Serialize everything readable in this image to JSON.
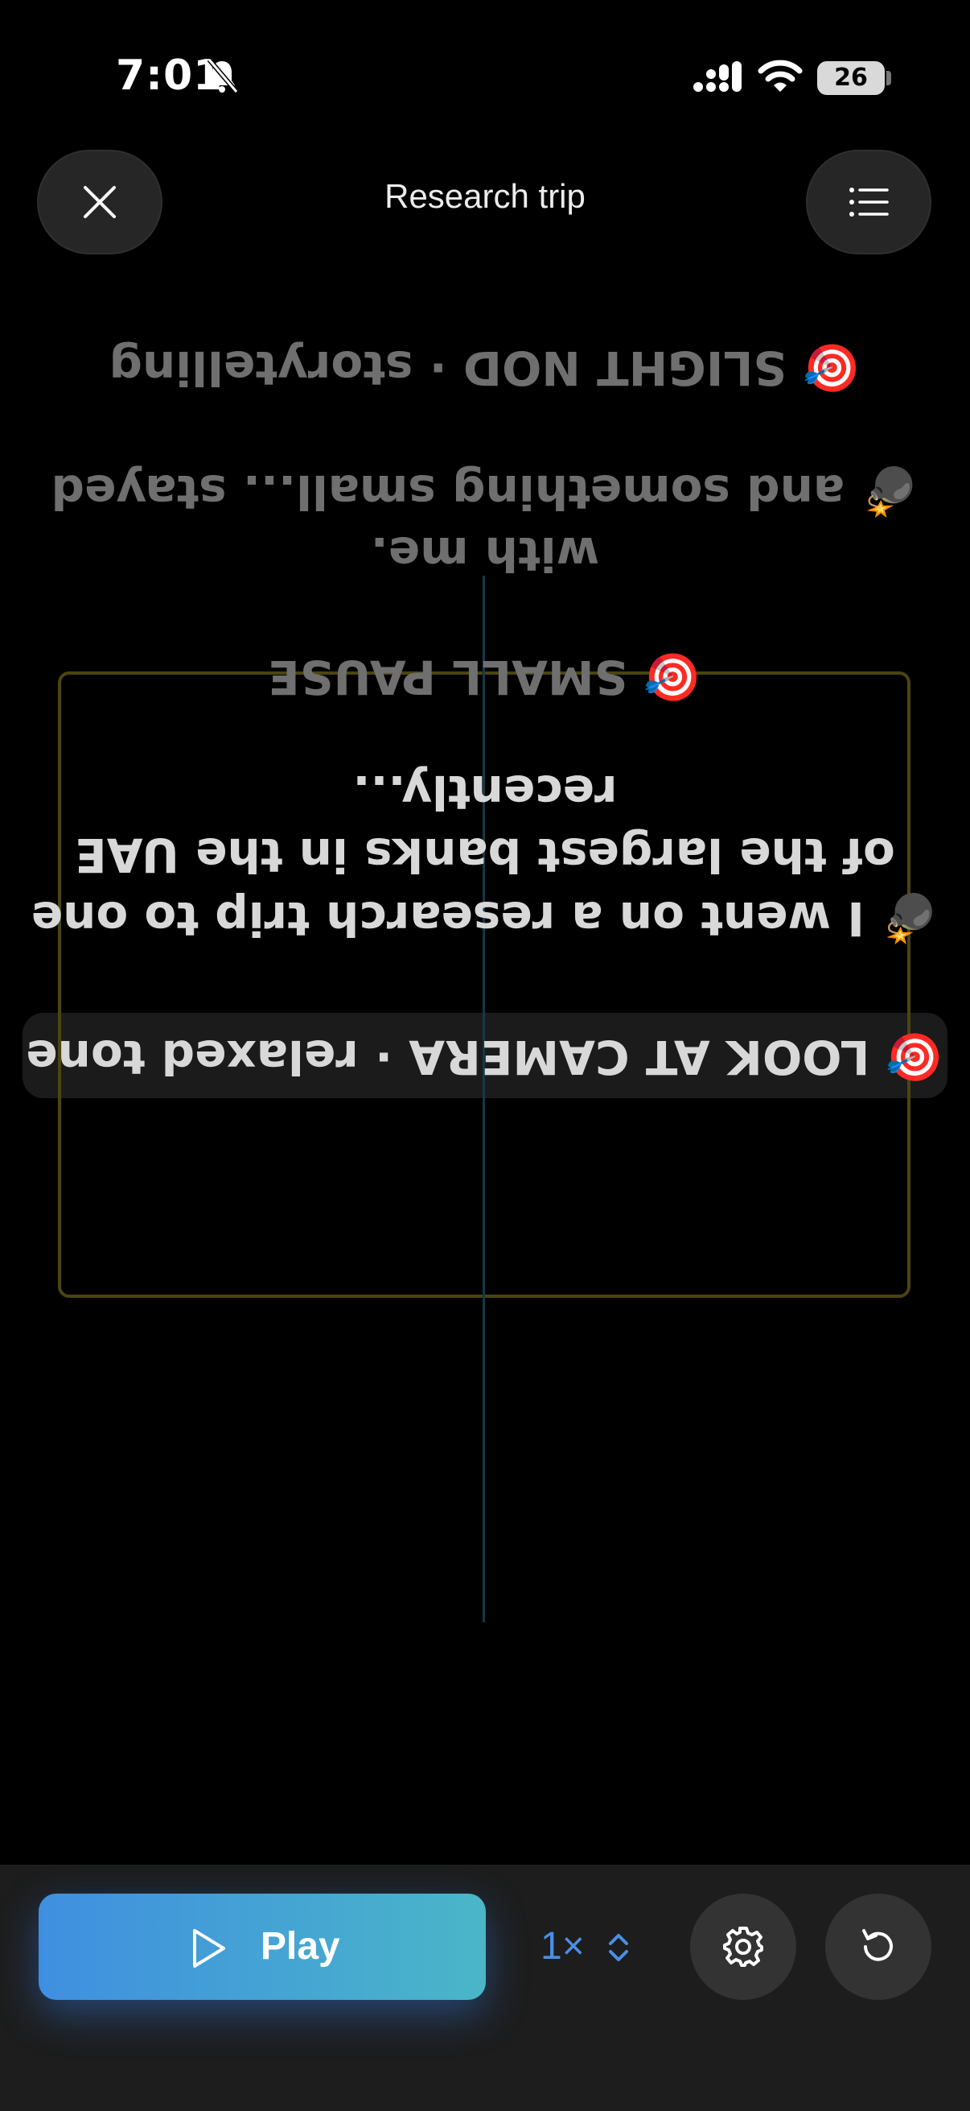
{
  "status_bar": {
    "time": "7:01",
    "battery": "26"
  },
  "header": {
    "title": "Research trip"
  },
  "script": {
    "lines": [
      {
        "text": "🎯 SLIGHT NOD · storytelling"
      },
      {
        "text": "💣 and something small... stayed"
      },
      {
        "text": "with me."
      },
      {
        "text": "🎯 SMALL PAUSE"
      },
      {
        "text": "recently..."
      },
      {
        "text": "of the largest banks in the UAE"
      },
      {
        "text": "💣 I went on a research trip to one"
      },
      {
        "text": "🎯 LOOK AT CAMERA · relaxed tone"
      }
    ]
  },
  "controls": {
    "play_label": "Play",
    "speed_label": "1×",
    "colors": {
      "accent": "#4a8fe6",
      "play_gradient_start": "#3f8fe0",
      "play_gradient_end": "#4ab6c8"
    }
  }
}
